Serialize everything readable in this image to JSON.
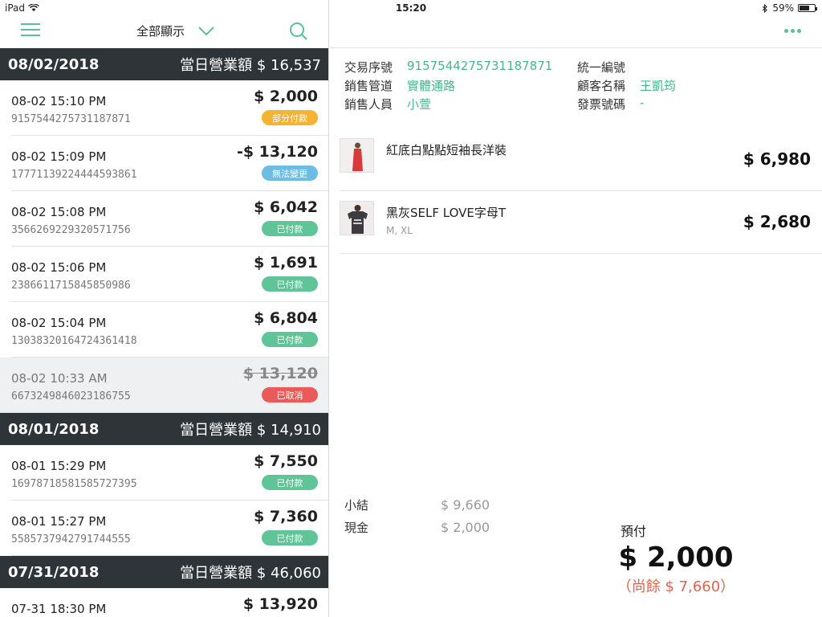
{
  "status_bar": {
    "device": "iPad",
    "time": "15:20",
    "battery": "59%"
  },
  "left_toolbar": {
    "filter_label": "全部顯示"
  },
  "days": [
    {
      "date": "08/02/2018",
      "total": "當日營業額 $ 16,537",
      "transactions": [
        {
          "time": "08-02 15:10 PM",
          "id": "9157544275731187871",
          "amount": "$ 2,000",
          "status": "部分付款",
          "status_color": "#f4b331"
        },
        {
          "time": "08-02 15:09 PM",
          "id": "17771139224444593861",
          "amount": "-$ 13,120",
          "status": "無法變更",
          "status_color": "#6bbde4"
        },
        {
          "time": "08-02 15:08 PM",
          "id": "3566269229320571756",
          "amount": "$ 6,042",
          "status": "已付款",
          "status_color": "#5fc497"
        },
        {
          "time": "08-02 15:06 PM",
          "id": "2386611715845850986",
          "amount": "$ 1,691",
          "status": "已付款",
          "status_color": "#5fc497"
        },
        {
          "time": "08-02 15:04 PM",
          "id": "13038320164724361418",
          "amount": "$ 6,804",
          "status": "已付款",
          "status_color": "#5fc497"
        },
        {
          "time": "08-02 10:33 AM",
          "id": "6673249846023186755",
          "amount": "$ 13,120",
          "status": "已取消",
          "status_color": "#ea5a5a"
        }
      ]
    },
    {
      "date": "08/01/2018",
      "total": "當日營業額 $ 14,910",
      "transactions": [
        {
          "time": "08-01 15:29 PM",
          "id": "16978718581585727395",
          "amount": "$ 7,550",
          "status": "已付款",
          "status_color": "#5fc497"
        },
        {
          "time": "08-01 15:27 PM",
          "id": "5585737942791744555",
          "amount": "$ 7,360",
          "status": "已付款",
          "status_color": "#5fc497"
        }
      ]
    },
    {
      "date": "07/31/2018",
      "total": "當日營業額 $ 46,060",
      "transactions": [
        {
          "time": "07-31 18:30 PM",
          "amount": "$ 13,920"
        }
      ]
    }
  ],
  "detail": {
    "info": {
      "txn_no_label": "交易序號",
      "txn_no": "9157544275731187871",
      "tax_id_label": "統一編號",
      "tax_id": "",
      "channel_label": "銷售管道",
      "channel": "實體通路",
      "customer_label": "顧客名稱",
      "customer": "王凱筠",
      "staff_label": "銷售人員",
      "staff": "小萱",
      "invoice_label": "發票號碼",
      "invoice": "-"
    },
    "items": [
      {
        "name": "紅底白點點短袖長洋裝",
        "variant": "",
        "price": "$ 6,980"
      },
      {
        "name": "黑灰SELF LOVE字母T",
        "variant": "M, XL",
        "price": "$ 2,680"
      }
    ],
    "summary": {
      "subtotal_label": "小結",
      "subtotal": "$ 9,660",
      "cash_label": "現金",
      "cash": "$ 2,000"
    },
    "prepay": {
      "label": "預付",
      "amount": "$ 2,000",
      "remaining": "（尚餘 $ 7,660）"
    }
  },
  "colors": {
    "accent": "#5bbf9a",
    "header_dark": "#2f3438"
  }
}
